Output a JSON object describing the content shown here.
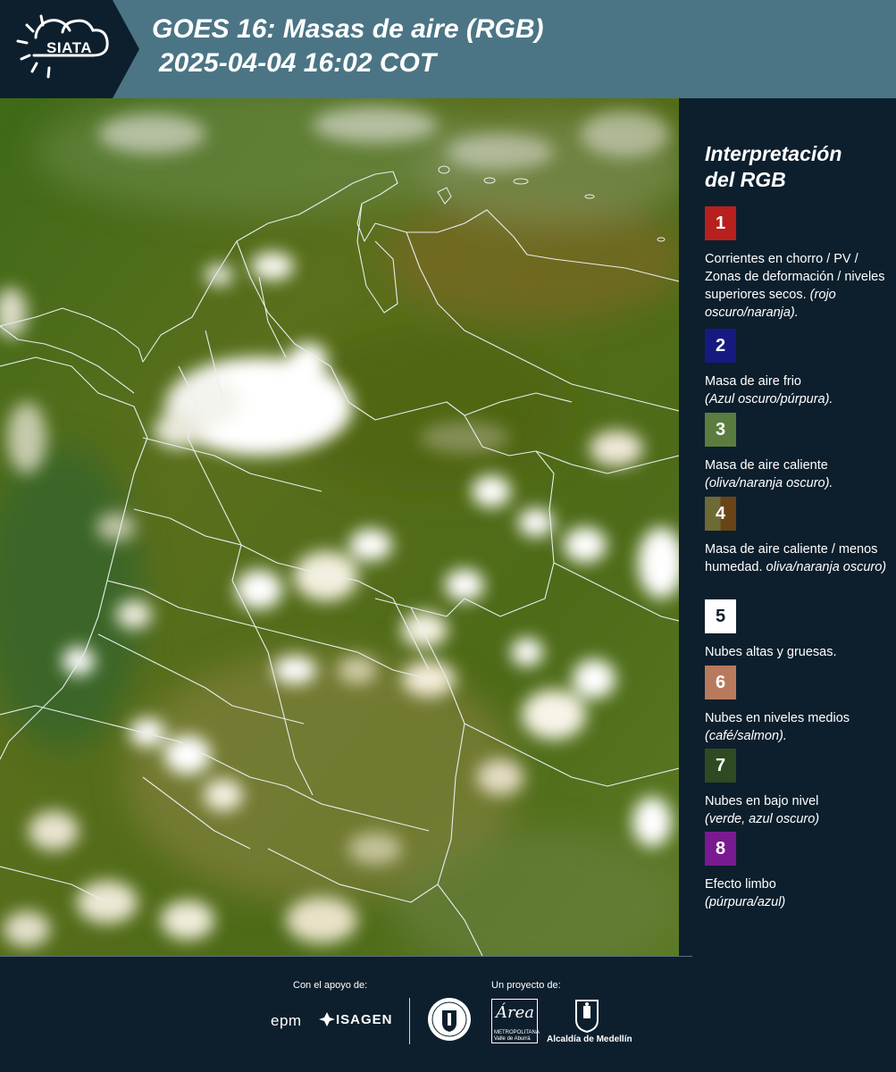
{
  "header": {
    "logo_text": "SIATA",
    "title_line1": "GOES 16: Masas de aire (RGB)",
    "title_line2": "2025-04-04 16:02 COT"
  },
  "legend": {
    "title_line1": "Interpretación",
    "title_line2": "del RGB",
    "items": [
      {
        "number": "1",
        "color": "#b8201e",
        "text": "Corrientes en chorro / PV / Zonas de deformación / niveles superiores secos.",
        "note": "(rojo oscuro/naranja)."
      },
      {
        "number": "2",
        "color": "#161a80",
        "text": "Masa de aire frio",
        "note": "(Azul oscuro/púrpura)."
      },
      {
        "number": "3",
        "color": "#5a7c3e",
        "text": "Masa de aire caliente",
        "note": "(oliva/naranja oscuro)."
      },
      {
        "number": "4",
        "color": "#6a5a2a",
        "text": "Masa de aire caliente / menos humedad.",
        "note": "oliva/naranja oscuro)"
      },
      {
        "number": "5",
        "color": "#ffffff",
        "text": "Nubes altas y gruesas.",
        "note": ""
      },
      {
        "number": "6",
        "color": "#b87a5c",
        "text": "Nubes en niveles medios",
        "note": "(café/salmon)."
      },
      {
        "number": "7",
        "color": "#2f4a22",
        "text": "Nubes en bajo nivel",
        "note": "(verde, azul oscuro)"
      },
      {
        "number": "8",
        "color": "#7a1a90",
        "text": "Efecto limbo",
        "note": "(púrpura/azul)"
      }
    ]
  },
  "footer": {
    "support_label": "Con el apoyo de:",
    "project_label": "Un proyecto de:",
    "sponsor1": "epm",
    "sponsor2": "ISAGEN",
    "area_name": "Área",
    "area_sub1": "METROPOLITANA",
    "area_sub2": "Valle de Aburrá",
    "alcaldia": "Alcaldía de Medellín"
  },
  "colors": {
    "header_bg": "#4b7585",
    "panel_bg": "#0d1f2d",
    "map_base": "#4a6a16"
  }
}
